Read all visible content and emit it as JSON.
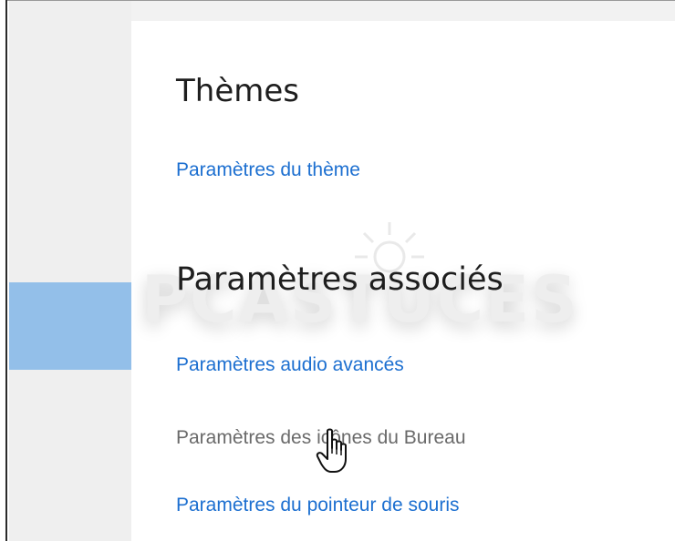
{
  "sections": {
    "themes": {
      "title": "Thèmes",
      "link": "Paramètres du thème"
    },
    "related": {
      "title": "Paramètres associés",
      "links": [
        "Paramètres audio avancés",
        "Paramètres des icônes du Bureau",
        "Paramètres du pointeur de souris"
      ]
    }
  },
  "watermark": {
    "text": "PCASTUCES"
  },
  "colors": {
    "link": "#1c6fd0",
    "link_hover": "#6a6a6a",
    "sidebar_selected": "#93bfe9",
    "sidebar": "#efefef"
  },
  "icons": {
    "cursor": "hand-pointer-icon",
    "watermark_logo": "sun-logo-icon"
  }
}
